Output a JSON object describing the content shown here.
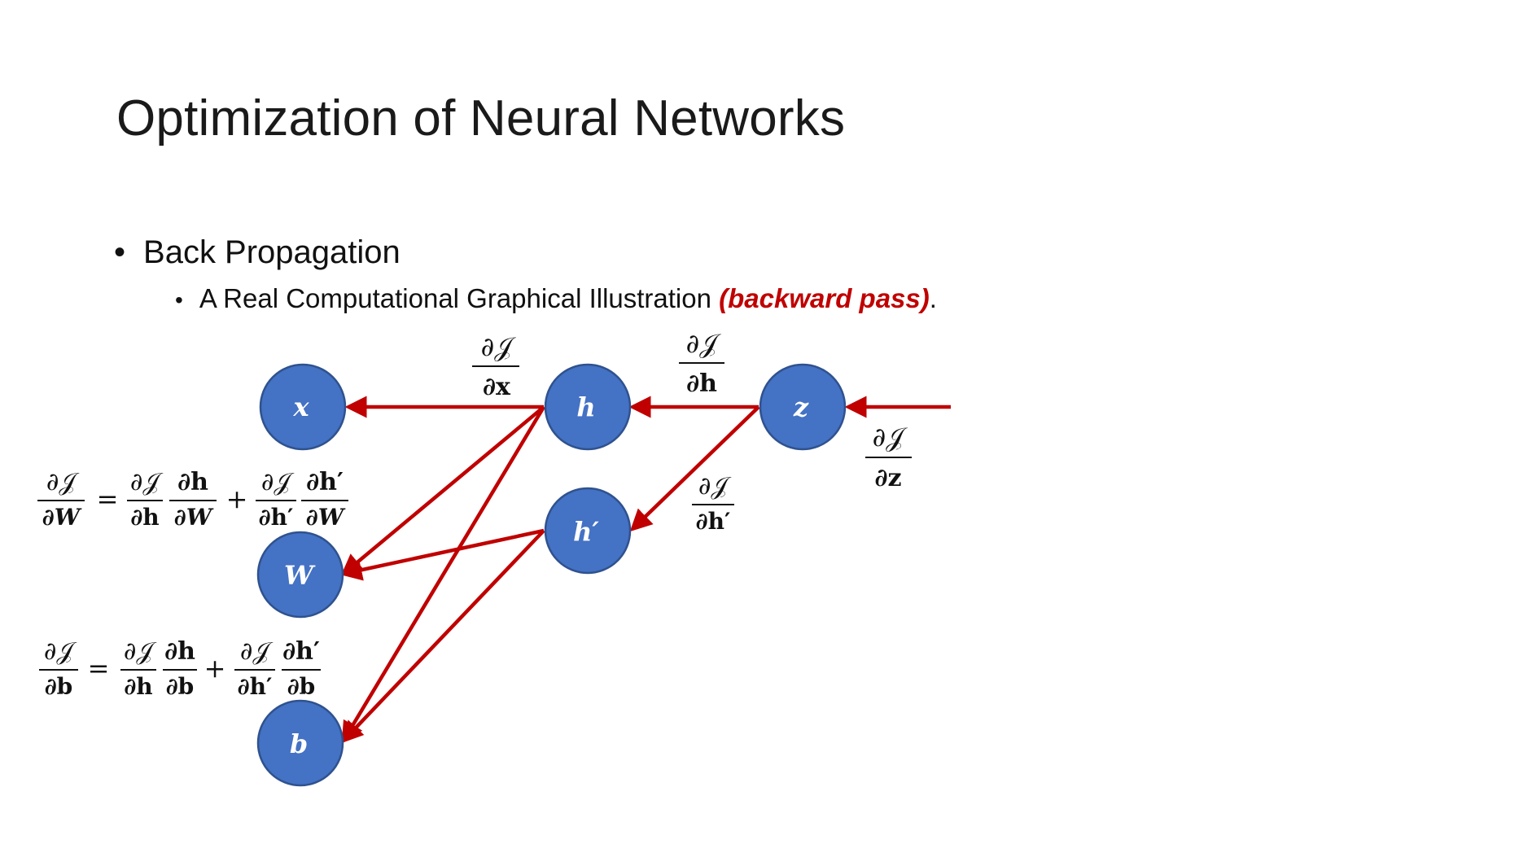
{
  "slide": {
    "title": "Optimization of Neural Networks",
    "bullet_level1": "Back Propagation",
    "bullet_level2_text": "A Real Computational Graphical Illustration ",
    "bullet_level2_emphasis": "(backward pass)",
    "bullet_level2_end": ".",
    "bullet_glyph": "•"
  },
  "colors": {
    "node_fill": "#4472c4",
    "node_stroke": "#2f528f",
    "edge": "#c00000",
    "emphasis": "#c00000"
  },
  "diagram": {
    "nodes": {
      "x": "x",
      "h": "h",
      "z": "z",
      "hprime": "h′",
      "W": "W",
      "b": "b"
    },
    "labels": {
      "dJ": "∂𝒥",
      "dx": "∂x",
      "dh": "∂h",
      "dz": "∂z",
      "dhp": "∂h′",
      "dW": "∂W",
      "db": "∂b",
      "eq": "=",
      "plus": "+"
    }
  }
}
